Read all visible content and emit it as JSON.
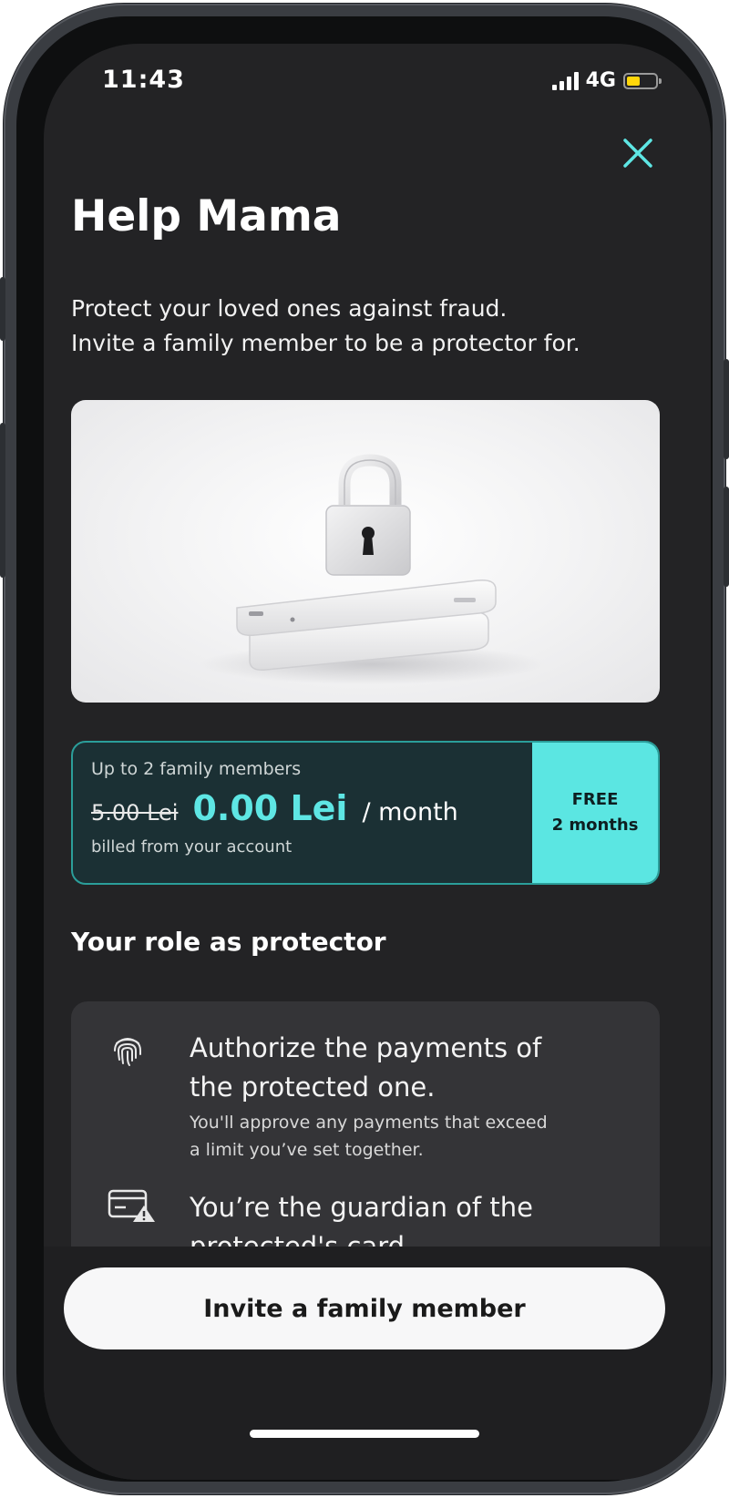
{
  "status_bar": {
    "time": "11:43",
    "network": "4G",
    "battery_level": 0.45,
    "signal_bars": 4
  },
  "header": {
    "title": "Help Mama",
    "close_icon": "close-icon"
  },
  "intro": {
    "line1": "Protect your loved ones against fraud.",
    "line2": "Invite a family member to be a protector for."
  },
  "hero": {
    "icon": "padlock-on-phones-illustration"
  },
  "pricing": {
    "members": "Up to 2 family members",
    "old_price": "5.00 Lei",
    "new_price": "0.00 Lei",
    "period": "/ month",
    "billed": "billed from your account",
    "promo_line1": "FREE",
    "promo_line2": "2 months"
  },
  "role": {
    "heading": "Your role as protector",
    "items": [
      {
        "icon": "fingerprint-icon",
        "title_line1": "Authorize the payments of",
        "title_line2": "the protected one.",
        "sub_line1": "You'll approve any payments that exceed",
        "sub_line2": "a limit you’ve set together."
      },
      {
        "icon": "card-warning-icon",
        "title_line1": "You’re the guardian of the",
        "title_line2": "protected's card"
      }
    ]
  },
  "cta": {
    "label": "Invite a family member"
  },
  "colors": {
    "background": "#232325",
    "accent": "#5ee6e4",
    "card": "#1b3034",
    "promo": "#5be6e2",
    "role_card": "#343437"
  }
}
